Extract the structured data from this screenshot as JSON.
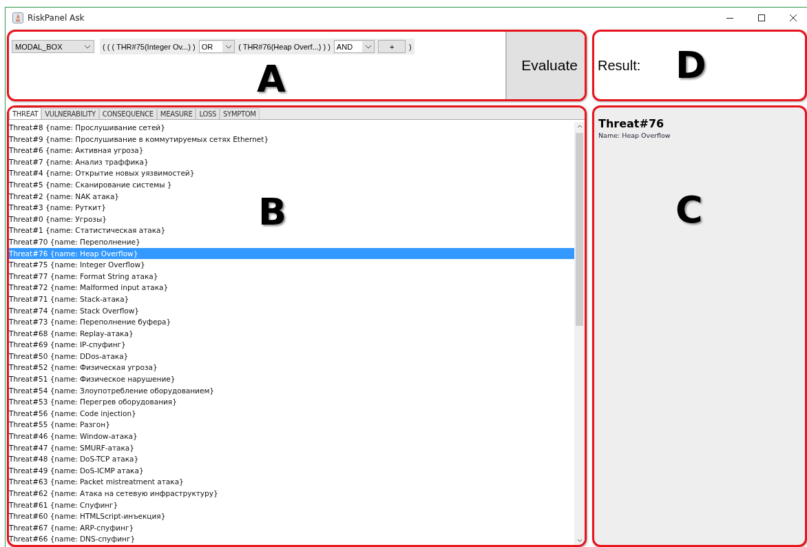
{
  "window": {
    "title": "RiskPanel Ask"
  },
  "query": {
    "annotation": "A",
    "mode_select": {
      "value": "MODAL_BOX"
    },
    "tokens": [
      {
        "kind": "text",
        "text": "( ( ( THR#75(Integer Ov...) )"
      },
      {
        "kind": "select",
        "value": "OR"
      },
      {
        "kind": "text",
        "text": "( THR#76(Heap Overf...) ) )"
      },
      {
        "kind": "select",
        "value": "AND"
      },
      {
        "kind": "button",
        "text": "+"
      },
      {
        "kind": "text",
        "text": ")"
      }
    ],
    "evaluate_button": "Evaluate"
  },
  "result": {
    "annotation": "D",
    "label": "Result:"
  },
  "list_panel": {
    "annotation": "B",
    "tabs": [
      {
        "label": "THREAT",
        "selected": true
      },
      {
        "label": "VULNERABILITY",
        "selected": false
      },
      {
        "label": "CONSEQUENCE",
        "selected": false
      },
      {
        "label": "MEASURE",
        "selected": false
      },
      {
        "label": "LOSS",
        "selected": false
      },
      {
        "label": "SYMPTOM",
        "selected": false
      }
    ],
    "items": [
      {
        "text": "Threat#8 {name: Прослушивание сетей}",
        "selected": false
      },
      {
        "text": "Threat#9 {name: Прослушивание в коммутируемых сетях Ethernet}",
        "selected": false
      },
      {
        "text": "Threat#6 {name: Активная угроза}",
        "selected": false
      },
      {
        "text": "Threat#7 {name: Анализ траффика}",
        "selected": false
      },
      {
        "text": "Threat#4 {name: Открытие новых уязвимостей}",
        "selected": false
      },
      {
        "text": "Threat#5 {name: Сканирование системы }",
        "selected": false
      },
      {
        "text": "Threat#2 {name: NAK атака}",
        "selected": false
      },
      {
        "text": "Threat#3 {name: Руткит}",
        "selected": false
      },
      {
        "text": "Threat#0 {name: Угрозы}",
        "selected": false
      },
      {
        "text": "Threat#1 {name: Статистическая атака}",
        "selected": false
      },
      {
        "text": "Threat#70 {name: Переполнение}",
        "selected": false
      },
      {
        "text": "Threat#76 {name: Heap Overflow}",
        "selected": true
      },
      {
        "text": "Threat#75 {name: Integer Overflow}",
        "selected": false
      },
      {
        "text": "Threat#77 {name: Format String атака}",
        "selected": false
      },
      {
        "text": "Threat#72 {name: Malformed input атака}",
        "selected": false
      },
      {
        "text": "Threat#71 {name: Stack-атака}",
        "selected": false
      },
      {
        "text": "Threat#74 {name: Stack Overflow}",
        "selected": false
      },
      {
        "text": "Threat#73 {name: Переполнение буфера}",
        "selected": false
      },
      {
        "text": "Threat#68 {name: Replay-атака}",
        "selected": false
      },
      {
        "text": "Threat#69 {name: IP-спуфинг}",
        "selected": false
      },
      {
        "text": "Threat#50 {name: DDos-атака}",
        "selected": false
      },
      {
        "text": "Threat#52 {name: Физическая угроза}",
        "selected": false
      },
      {
        "text": "Threat#51 {name: Физическое нарушение}",
        "selected": false
      },
      {
        "text": "Threat#54 {name: Злоупотребление оборудованием}",
        "selected": false
      },
      {
        "text": "Threat#53 {name: Перегрев оборудования}",
        "selected": false
      },
      {
        "text": "Threat#56 {name: Code injection}",
        "selected": false
      },
      {
        "text": "Threat#55 {name: Разгон}",
        "selected": false
      },
      {
        "text": "Threat#46 {name: Window-атака}",
        "selected": false
      },
      {
        "text": "Threat#47 {name: SMURF-атака}",
        "selected": false
      },
      {
        "text": "Threat#48 {name: DoS-TCP атака}",
        "selected": false
      },
      {
        "text": "Threat#49 {name: DoS-ICMP атака}",
        "selected": false
      },
      {
        "text": "Threat#63 {name: Packet mistreatment атака}",
        "selected": false
      },
      {
        "text": "Threat#62 {name: Атака на сетевую инфраструктуру}",
        "selected": false
      },
      {
        "text": "Threat#61 {name: Спуфинг}",
        "selected": false
      },
      {
        "text": "Threat#60 {name: HTMLScript-инъекция}",
        "selected": false
      },
      {
        "text": "Threat#67 {name: ARP-спуфинг}",
        "selected": false
      },
      {
        "text": "Threat#66 {name: DNS-спуфинг}",
        "selected": false
      }
    ]
  },
  "details": {
    "annotation": "C",
    "title": "Threat#76",
    "name_line": "Name: Heap Overflow"
  }
}
